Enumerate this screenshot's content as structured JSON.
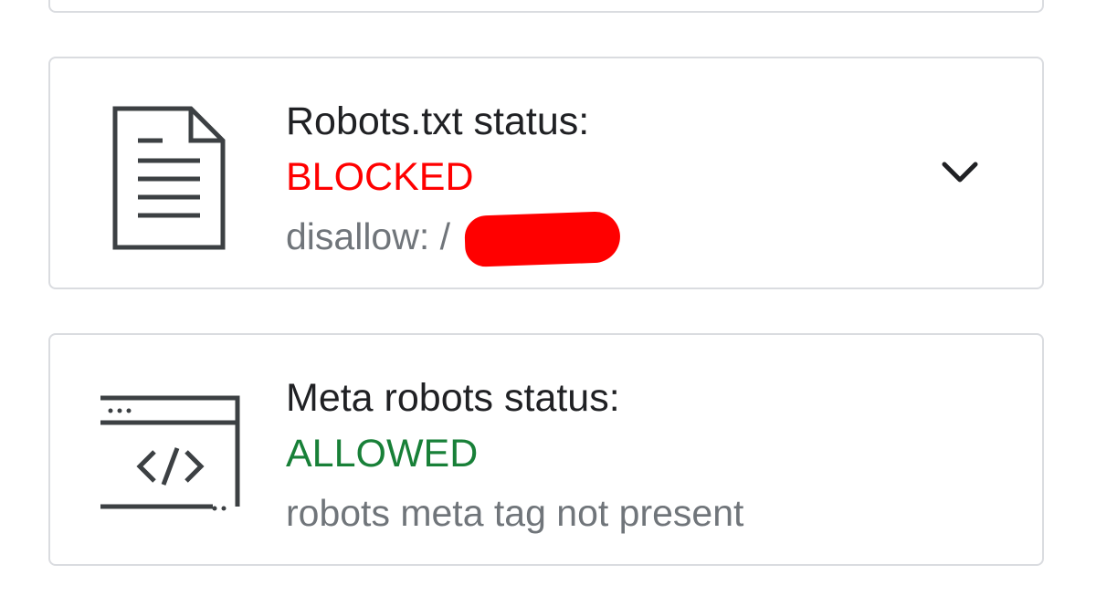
{
  "cards": [
    {
      "id": "robots-txt",
      "icon": "document-icon",
      "title": "Robots.txt status:",
      "status": "BLOCKED",
      "status_color": "#ff0000",
      "detail": "disallow: /",
      "detail_redacted": true,
      "expandable": true
    },
    {
      "id": "meta-robots",
      "icon": "code-window-icon",
      "title": "Meta robots status:",
      "status": "ALLOWED",
      "status_color": "#188038",
      "detail": "robots meta tag not present",
      "expandable": false
    }
  ],
  "colors": {
    "blocked": "#ff0000",
    "allowed": "#188038",
    "title": "#202124",
    "detail": "#70757a",
    "border": "#dadce0"
  }
}
